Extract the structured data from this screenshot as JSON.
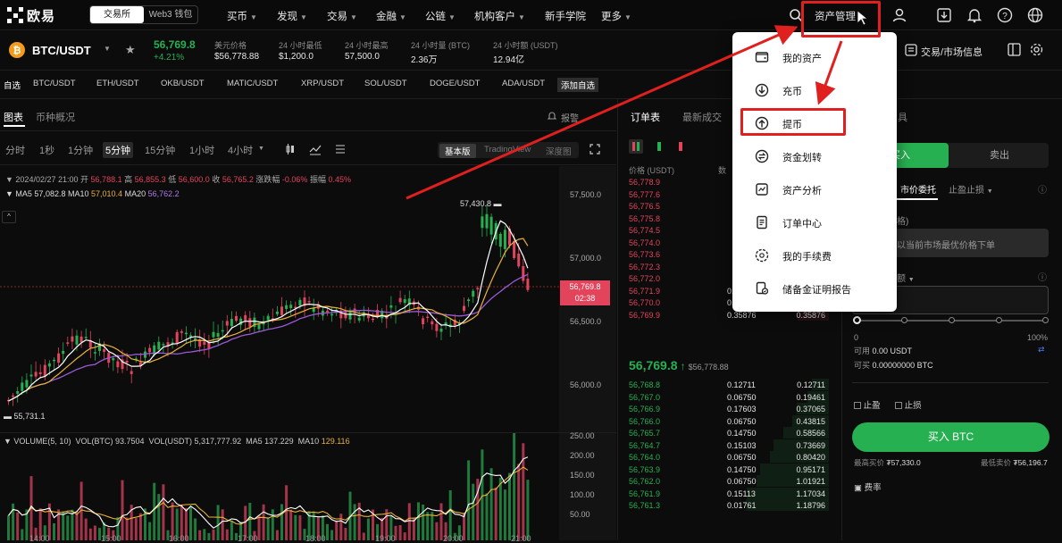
{
  "nav": {
    "logo": "欧易",
    "mode_tabs": [
      "交易所",
      "Web3 钱包"
    ],
    "items": [
      "买币",
      "发现",
      "交易",
      "金融",
      "公链",
      "机构客户",
      "新手学院",
      "更多"
    ],
    "asset_mgmt": "资产管理"
  },
  "ticker": {
    "pair": "BTC/USDT",
    "price": "56,769.8",
    "change": "+4.21%",
    "stats": [
      {
        "label": "美元价格",
        "value": "$56,778.88"
      },
      {
        "label": "24 小时最低",
        "value": "$1,200.0"
      },
      {
        "label": "24 小时最高",
        "value": "57,500.0"
      },
      {
        "label": "24 小时量 (BTC)",
        "value": "2.36万"
      },
      {
        "label": "24 小时额 (USDT)",
        "value": "12.94亿"
      }
    ],
    "right_link": "交易/市场信息"
  },
  "favs": [
    "自选",
    "BTC/USDT",
    "ETH/USDT",
    "OKB/USDT",
    "MATIC/USDT",
    "XRP/USDT",
    "SOL/USDT",
    "DOGE/USDT",
    "ADA/USDT",
    "添加自选"
  ],
  "chart_tabs": [
    "图表",
    "币种概况"
  ],
  "alert": "报警",
  "timeframes": [
    "分时",
    "1秒",
    "1分钟",
    "5分钟",
    "15分钟",
    "1小时",
    "4小时"
  ],
  "views": [
    "基本版",
    "TradingView",
    "深度图"
  ],
  "ohlc": {
    "date": "2024/02/27 21:00",
    "o_lbl": "开",
    "o": "56,788.1",
    "h_lbl": "高",
    "h": "56,855.3",
    "l_lbl": "低",
    "l": "56,600.0",
    "c_lbl": "收",
    "c": "56,765.2",
    "chg_lbl": "涨跌幅",
    "chg": "-0.06%",
    "amp_lbl": "振幅",
    "amp": "0.45%"
  },
  "ma": {
    "ma5": "MA5 57,082.8",
    "ma10_lbl": "MA10",
    "ma10": "57,010.4",
    "ma20_lbl": "MA20",
    "ma20": "56,762.2"
  },
  "chart_labels": {
    "high": "57,430.8",
    "low": "55,731.1",
    "current": "56,769.8",
    "countdown": "02:38"
  },
  "y_axis": [
    "57,500.0",
    "57,000.0",
    "56,500.0",
    "56,000.0"
  ],
  "volume": {
    "title": "VOLUME(5, 10)",
    "vol_btc": "VOL(BTC) 93.7504",
    "vol_usdt": "VOL(USDT) 5,317,777.92",
    "ma5": "MA5 137.229",
    "ma10_lbl": "MA10",
    "ma10": "129.116"
  },
  "vol_axis": [
    "250.00",
    "200.00",
    "150.00",
    "100.00",
    "50.00"
  ],
  "x_axis": [
    "14:00",
    "15:00",
    "16:00",
    "17:00",
    "18:00",
    "19:00",
    "20:00",
    "21:00"
  ],
  "orderbook": {
    "tabs": [
      "订单表",
      "最新成交"
    ],
    "col_price": "价格 (USDT)",
    "col_amt": "数",
    "asks": [
      {
        "p": "56,778.9",
        "a": "",
        "t": ""
      },
      {
        "p": "56,777.6",
        "a": "",
        "t": ""
      },
      {
        "p": "56,776.5",
        "a": "",
        "t": ""
      },
      {
        "p": "56,775.8",
        "a": "",
        "t": ""
      },
      {
        "p": "56,774.5",
        "a": "",
        "t": ""
      },
      {
        "p": "56,774.0",
        "a": "",
        "t": ""
      },
      {
        "p": "56,773.6",
        "a": "",
        "t": ""
      },
      {
        "p": "56,772.3",
        "a": "",
        "t": ""
      },
      {
        "p": "56,772.0",
        "a": "",
        "t": ""
      },
      {
        "p": "56,771.9",
        "a": "0.14056",
        "t": "0.56683"
      },
      {
        "p": "56,770.0",
        "a": "0.06750",
        "t": "0.42626"
      },
      {
        "p": "56,769.9",
        "a": "0.35876",
        "t": "0.35876"
      }
    ],
    "mid_price": "56,769.8",
    "mid_arrow": "↑",
    "mid_usd": "$56,778.88",
    "bids": [
      {
        "p": "56,768.8",
        "a": "0.12711",
        "t": "0.12711"
      },
      {
        "p": "56,767.0",
        "a": "0.06750",
        "t": "0.19461"
      },
      {
        "p": "56,766.9",
        "a": "0.17603",
        "t": "0.37065"
      },
      {
        "p": "56,766.0",
        "a": "0.06750",
        "t": "0.43815"
      },
      {
        "p": "56,765.7",
        "a": "0.14750",
        "t": "0.58566"
      },
      {
        "p": "56,764.7",
        "a": "0.15103",
        "t": "0.73669"
      },
      {
        "p": "56,764.0",
        "a": "0.06750",
        "t": "0.80420"
      },
      {
        "p": "56,763.9",
        "a": "0.14750",
        "t": "0.95171"
      },
      {
        "p": "56,762.0",
        "a": "0.06750",
        "t": "1.01921"
      },
      {
        "p": "56,761.9",
        "a": "0.15113",
        "t": "1.17034"
      },
      {
        "p": "56,761.3",
        "a": "0.01761",
        "t": "1.18796"
      }
    ]
  },
  "trade": {
    "header": "具",
    "buy": "买入",
    "sell": "卖出",
    "order_type": "市价委托",
    "stop": "止盈止损",
    "label_frag": "格)",
    "placeholder": "以当前市场最优价格下单",
    "label_frag2": "额",
    "pct_min": "0",
    "pct_max": "100%",
    "avail_usdt": "0.00 USDT",
    "avail_btc": "0.00000000 BTC",
    "avail_lbl": "可用",
    "avail_lbl2": "可买",
    "tp": "止盈",
    "sl": "止损",
    "buy_btn": "买入 BTC",
    "max_buy_lbl": "最高买价",
    "max_buy": "₮57,330.0",
    "min_sell_lbl": "最低卖价",
    "min_sell": "₮56,196.7",
    "fee": "费率"
  },
  "dropdown": [
    "我的资产",
    "充币",
    "提币",
    "资金划转",
    "资产分析",
    "订单中心",
    "我的手续费",
    "储备金证明报告"
  ],
  "colors": {
    "up": "#27b052",
    "down": "#e2445c",
    "ma5": "#ffffff",
    "ma10": "#e8b23a",
    "ma20": "#9a5ad6",
    "highlight": "#e0201e"
  }
}
